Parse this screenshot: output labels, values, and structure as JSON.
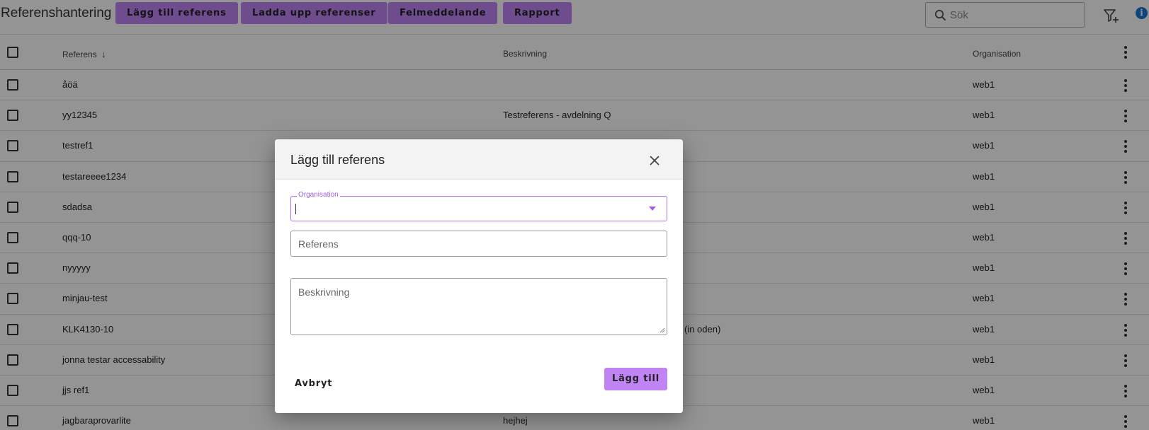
{
  "app": {
    "title": "Referenshantering"
  },
  "toolbar": {
    "add_label": "Lägg till referens",
    "upload_label": "Ladda upp referenser",
    "errors_label": "Felmeddelande",
    "report_label": "Rapport"
  },
  "search": {
    "placeholder": "Sök"
  },
  "icons": {
    "search": "search-icon",
    "filter": "filter-add-icon",
    "info": "info-icon",
    "more": "more-vert-icon",
    "close": "close-icon",
    "sort": "arrow-down-icon"
  },
  "colors": {
    "accent": "#c084f5",
    "focus": "#b46ef0",
    "info": "#1976d2"
  },
  "table": {
    "columns": {
      "reference": "Referens",
      "sort_indicator": "↓",
      "description": "Beskrivning",
      "organisation": "Organisation"
    },
    "rows": [
      {
        "reference": "åöä",
        "description": "",
        "organisation": "web1"
      },
      {
        "reference": "yy12345",
        "description": "Testreferens - avdelning Q",
        "organisation": "web1"
      },
      {
        "reference": "testref1",
        "description": "",
        "organisation": "web1"
      },
      {
        "reference": "testareeee1234",
        "description": "",
        "organisation": "web1"
      },
      {
        "reference": "sdadsa",
        "description": "",
        "organisation": "web1"
      },
      {
        "reference": "qqq-10",
        "description": "",
        "organisation": "web1"
      },
      {
        "reference": "nyyyyy",
        "description": "",
        "organisation": "web1"
      },
      {
        "reference": "minjau-test",
        "description": "",
        "organisation": "web1"
      },
      {
        "reference": "KLK4130-10",
        "description": "(in oden)",
        "organisation": "web1"
      },
      {
        "reference": "jonna testar accessability",
        "description": "",
        "organisation": "web1"
      },
      {
        "reference": "jjs ref1",
        "description": "",
        "organisation": "web1"
      },
      {
        "reference": "jagbaraprovarlite",
        "description": "hejhej",
        "organisation": "web1"
      }
    ]
  },
  "dialog": {
    "title": "Lägg till referens",
    "organisation_label": "Organisation",
    "organisation_value": "",
    "reference_placeholder": "Referens",
    "description_placeholder": "Beskrivning",
    "cancel_label": "Avbryt",
    "submit_label": "Lägg till"
  }
}
